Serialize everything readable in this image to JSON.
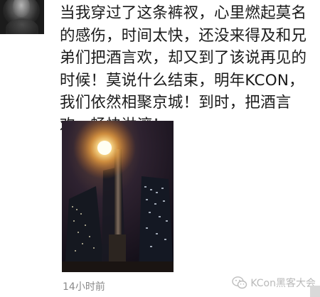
{
  "post": {
    "text": "当我穿过了这条裤衩，心里燃起莫名的感伤，时间太快，还没来得及和兄弟们把酒言欢，却又到了该说再见的时候！莫说什么结束，明年KCON，我们依然相聚京城！到时，把酒言欢，畅快淋漓！",
    "timestamp": "14小时前"
  },
  "watermark": {
    "text": "KCon黑客大会",
    "icon": "wechat-icon"
  },
  "photo": {
    "description_icon": "night-cityscape-photo"
  }
}
